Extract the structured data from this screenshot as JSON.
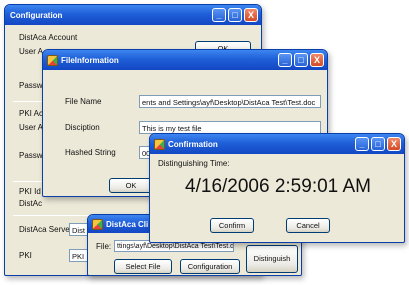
{
  "config_window": {
    "title": "Configuration",
    "distaca_account_label": "DistAca Account",
    "user_label_1": "User A",
    "password_label_1": "Passw",
    "ok_label": "OK",
    "pki_label": "PKI Ac",
    "user_label_2": "User A",
    "password_label_2": "Passw",
    "pki_id_label": "PKI Id",
    "distaca_label": "DistAc",
    "server_label": "DistAca Server:",
    "server_value": "Dist",
    "pki_short_label": "PKI",
    "pki_value": "PKI"
  },
  "file_window": {
    "title": "FileInformation",
    "file_name_label": "File Name",
    "file_name_value": "ents and Settings\\ayf\\Desktop\\DistAca Test\\Test.doc",
    "description_label": "Disciption",
    "description_value": "This is my test file",
    "hash_label": "Hashed String",
    "hash_value": "00640014",
    "ok_label": "OK"
  },
  "client_window": {
    "title": "DistAca Cli",
    "file_label": "File:",
    "file_value": "ttings\\ayf\\Desktop\\DistAca Test\\Test.doc",
    "select_file_label": "Select File",
    "configuration_label": "Configuration",
    "distinguish_label": "Distinguish"
  },
  "confirm_window": {
    "title": "Confirmation",
    "time_label": "Distinguishing Time:",
    "time_value": "4/16/2006 2:59:01 AM",
    "confirm_label": "Confirm",
    "cancel_label": "Cancel"
  },
  "window_buttons": {
    "minimize": "_",
    "maximize": "□",
    "close": "X"
  },
  "colors": {
    "titlebar": "#1f5fd8",
    "window_bg": "#ece9d8",
    "close_button": "#d34a24"
  }
}
